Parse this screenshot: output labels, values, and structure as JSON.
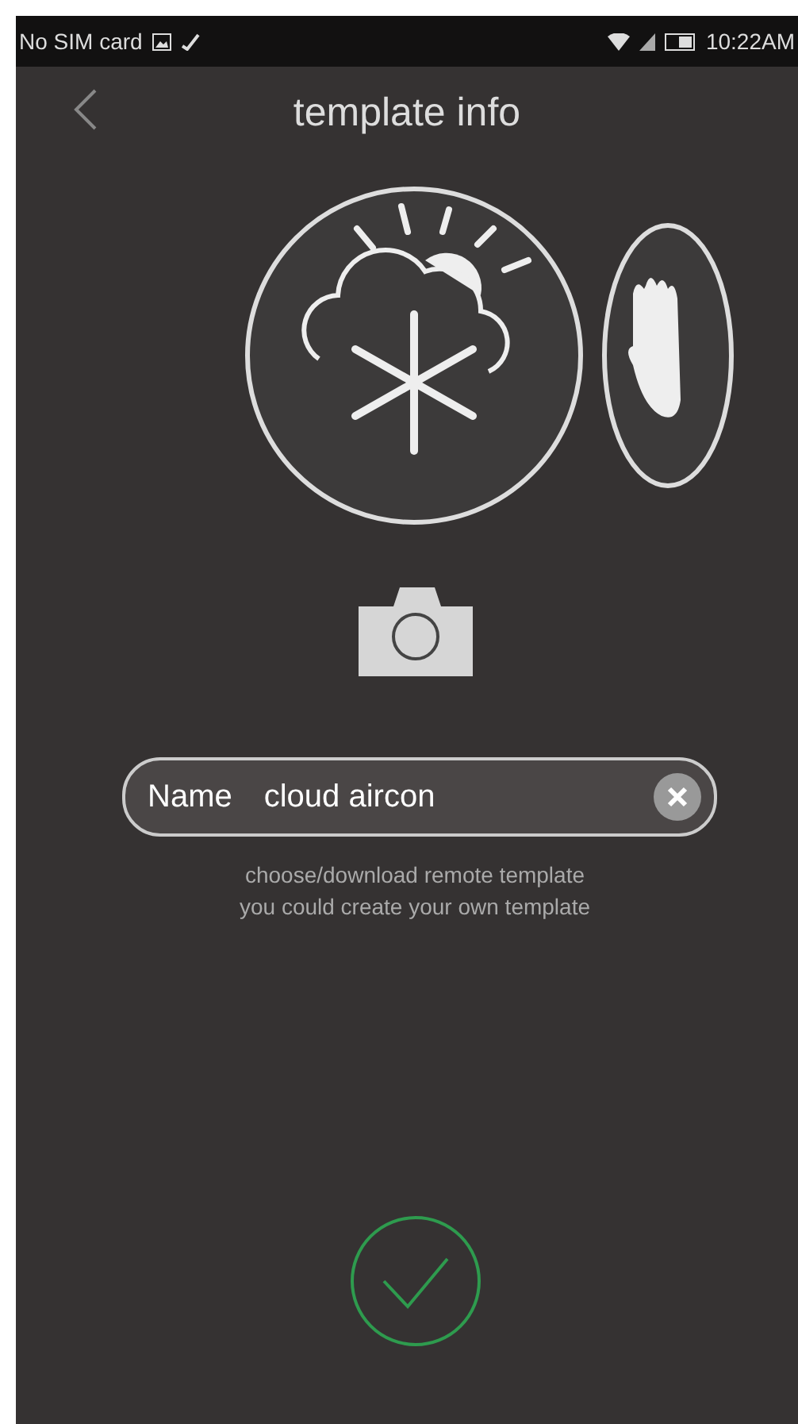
{
  "status_bar": {
    "carrier": "No SIM card",
    "time": "10:22AM"
  },
  "header": {
    "title": "template info"
  },
  "name_field": {
    "label": "Name",
    "value": "cloud aircon"
  },
  "hints": [
    "choose/download remote template",
    "you could create your own template"
  ]
}
